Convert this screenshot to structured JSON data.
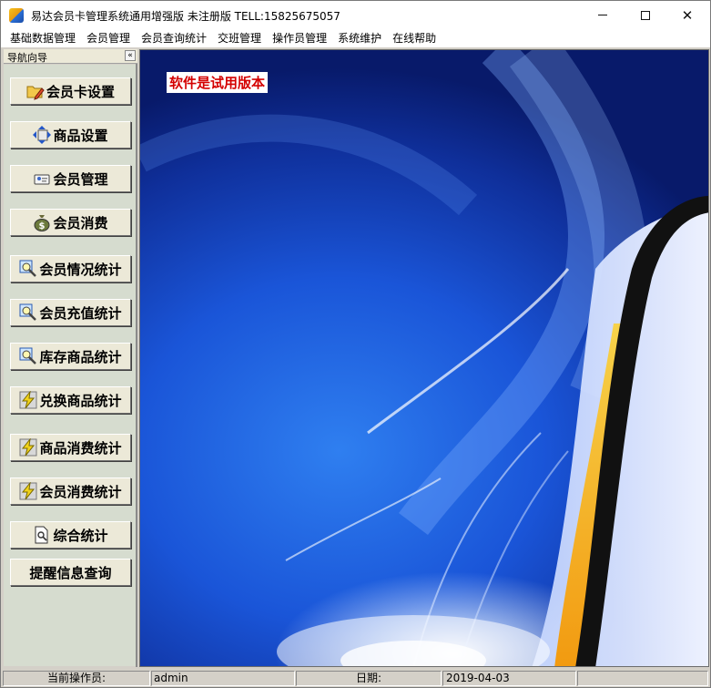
{
  "window": {
    "title": "易达会员卡管理系统通用增强版 未注册版 TELL:15825675057",
    "controls": {
      "minimize_icon": "minimize-icon",
      "maximize_icon": "maximize-icon",
      "close_glyph": "✕"
    }
  },
  "menu": {
    "items": [
      "基础数据管理",
      "会员管理",
      "会员查询统计",
      "交班管理",
      "操作员管理",
      "系统维护",
      "在线帮助"
    ]
  },
  "nav": {
    "title": "导航向导",
    "collapse_glyph": "«",
    "buttons": [
      {
        "label": "会员卡设置",
        "icon": "folder-pencil-icon"
      },
      {
        "label": "商品设置",
        "icon": "move-arrows-icon"
      },
      {
        "label": "会员管理",
        "icon": "card-user-icon"
      },
      {
        "label": "会员消费",
        "icon": "money-bag-icon"
      },
      {
        "label": "会员情况统计",
        "icon": "magnifier-chart-icon"
      },
      {
        "label": "会员充值统计",
        "icon": "magnifier-chart-icon"
      },
      {
        "label": "库存商品统计",
        "icon": "magnifier-chart-icon"
      },
      {
        "label": "兑换商品统计",
        "icon": "lightning-icon"
      },
      {
        "label": "商品消费统计",
        "icon": "lightning-icon"
      },
      {
        "label": "会员消费统计",
        "icon": "lightning-icon"
      },
      {
        "label": "综合统计",
        "icon": "document-search-icon"
      },
      {
        "label": "提醒信息查询",
        "icon": ""
      }
    ]
  },
  "content": {
    "trial_notice": "软件是试用版本"
  },
  "status": {
    "operator_label": "当前操作员:",
    "operator_value": "admin",
    "date_label": "日期:",
    "date_value": "2019-04-03"
  },
  "colors": {
    "trial_text": "#d40000",
    "background_blue": "#1a55d8",
    "accent_yellow": "#f2b31c"
  }
}
